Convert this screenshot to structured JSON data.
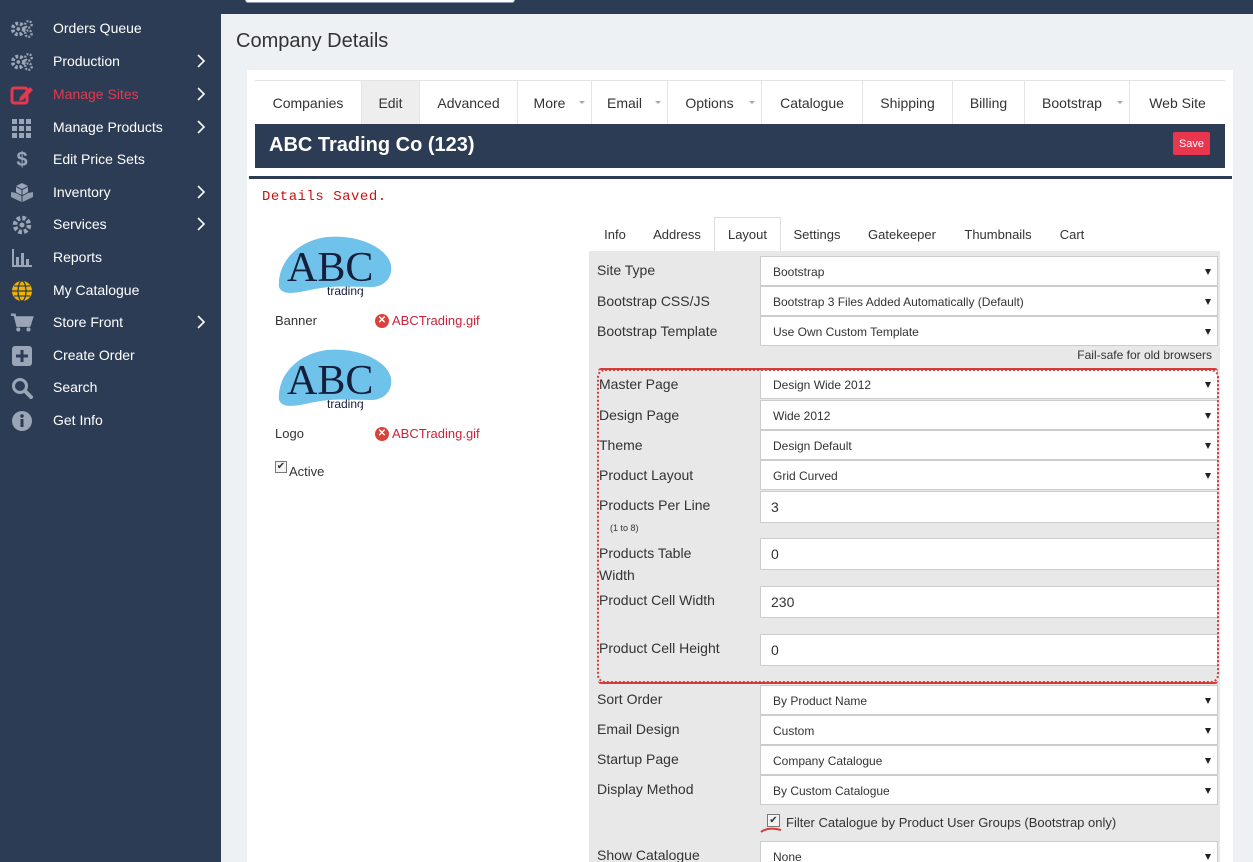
{
  "sidebar": {
    "items": [
      {
        "label": "Orders Queue",
        "icon": "gears-icon"
      },
      {
        "label": "Production",
        "icon": "gears-icon"
      },
      {
        "label": "Manage Sites",
        "icon": "edit-icon"
      },
      {
        "label": "Manage Products",
        "icon": "grid-icon"
      },
      {
        "label": "Edit Price Sets",
        "icon": "dollar-icon"
      },
      {
        "label": "Inventory",
        "icon": "boxes-icon"
      },
      {
        "label": "Services",
        "icon": "gear-icon"
      },
      {
        "label": "Reports",
        "icon": "bar-chart-icon"
      },
      {
        "label": "My Catalogue",
        "icon": "globe-icon"
      },
      {
        "label": "Store Front",
        "icon": "cart-icon"
      },
      {
        "label": "Create Order",
        "icon": "plus-square-icon"
      },
      {
        "label": "Search",
        "icon": "search-icon"
      },
      {
        "label": "Get Info",
        "icon": "info-icon"
      }
    ]
  },
  "page": {
    "title": "Company Details"
  },
  "tabs": [
    "Companies",
    "Edit",
    "Advanced",
    "More",
    "Email",
    "Options",
    "Catalogue",
    "Shipping",
    "Billing",
    "Bootstrap",
    "Web Site"
  ],
  "header": {
    "company_name": "ABC Trading Co (123)",
    "save_label": "Save"
  },
  "status": {
    "message": "Details Saved."
  },
  "images": {
    "banner_label": "Banner",
    "banner_file": "ABCTrading.gif",
    "logo_label": "Logo",
    "logo_file": "ABCTrading.gif",
    "logo_text": "ABC",
    "logo_subtext": "trading"
  },
  "active": {
    "label": "Active",
    "checked": true
  },
  "subtabs": [
    "Info",
    "Address",
    "Layout",
    "Settings",
    "Gatekeeper",
    "Thumbnails",
    "Cart"
  ],
  "form": {
    "site_type": {
      "label": "Site Type",
      "value": "Bootstrap"
    },
    "bootstrap_css": {
      "label": "Bootstrap CSS/JS",
      "value": "Bootstrap 3 Files Added Automatically (Default)"
    },
    "bootstrap_template": {
      "label": "Bootstrap Template",
      "value": "Use Own Custom Template"
    },
    "failsafe_note": "Fail-safe for old browsers",
    "master_page": {
      "label": "Master Page",
      "value": "Design Wide 2012"
    },
    "design_page": {
      "label": "Design Page",
      "value": "Wide 2012"
    },
    "theme": {
      "label": "Theme",
      "value": "Design Default"
    },
    "product_layout": {
      "label": "Product Layout",
      "value": "Grid Curved"
    },
    "products_per_line": {
      "label": "Products Per Line",
      "hint": "(1 to 8)",
      "value": "3"
    },
    "products_table_width": {
      "label_line1": "Products Table",
      "label_line2": "Width",
      "value": "0"
    },
    "product_cell_width": {
      "label": "Product Cell Width",
      "value": "230"
    },
    "product_cell_height": {
      "label": "Product Cell Height",
      "value": "0"
    },
    "sort_order": {
      "label": "Sort Order",
      "value": "By Product Name"
    },
    "email_design": {
      "label": "Email Design",
      "value": "Custom"
    },
    "startup_page": {
      "label": "Startup Page",
      "value": "Company Catalogue"
    },
    "display_method": {
      "label": "Display Method",
      "value": "By Custom Catalogue"
    },
    "filter_catalogue": {
      "label": "Filter Catalogue by Product User Groups (Bootstrap only)",
      "checked": true
    },
    "show_catalogue": {
      "label": "Show Catalogue",
      "value": "None"
    }
  },
  "colors": {
    "sidebar": "#2c3c55",
    "accent": "#e8364f",
    "highlight": "#d63b3b"
  }
}
